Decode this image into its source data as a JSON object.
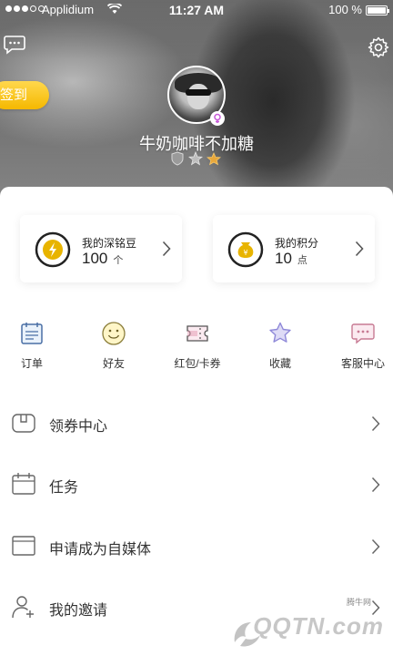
{
  "status_bar": {
    "carrier": "Applidium",
    "time": "11:27 AM",
    "battery": "100 %",
    "battery_level": 1.0
  },
  "header": {
    "checkin_label": "签到",
    "username": "牛奶咖啡不加糖"
  },
  "cards": [
    {
      "title": "我的深铭豆",
      "value": "100",
      "unit": "个",
      "icon": "coin-icon"
    },
    {
      "title": "我的积分",
      "value": "10",
      "unit": "点",
      "icon": "money-bag-icon"
    }
  ],
  "quick_actions": [
    {
      "label": "订单",
      "icon": "order-calendar-icon"
    },
    {
      "label": "好友",
      "icon": "smile-face-icon"
    },
    {
      "label": "红包/卡券",
      "icon": "coupon-icon"
    },
    {
      "label": "收藏",
      "icon": "star-icon"
    },
    {
      "label": "客服中心",
      "icon": "chat-bubble-icon"
    }
  ],
  "menu": [
    {
      "label": "领券中心",
      "icon": "coupon-pocket-icon"
    },
    {
      "label": "任务",
      "icon": "calendar-icon"
    },
    {
      "label": "申请成为自媒体",
      "icon": "browser-window-icon"
    },
    {
      "label": "我的邀请",
      "icon": "add-user-icon"
    }
  ],
  "watermark": {
    "small": "腾牛网",
    "big": "QQTN.com"
  },
  "colors": {
    "checkin_yellow": "#f5b800",
    "accent_gold": "#e8b400",
    "text_dark": "#333333",
    "icon_blue": "#4a6fa5",
    "icon_purple": "#8e88d8"
  }
}
